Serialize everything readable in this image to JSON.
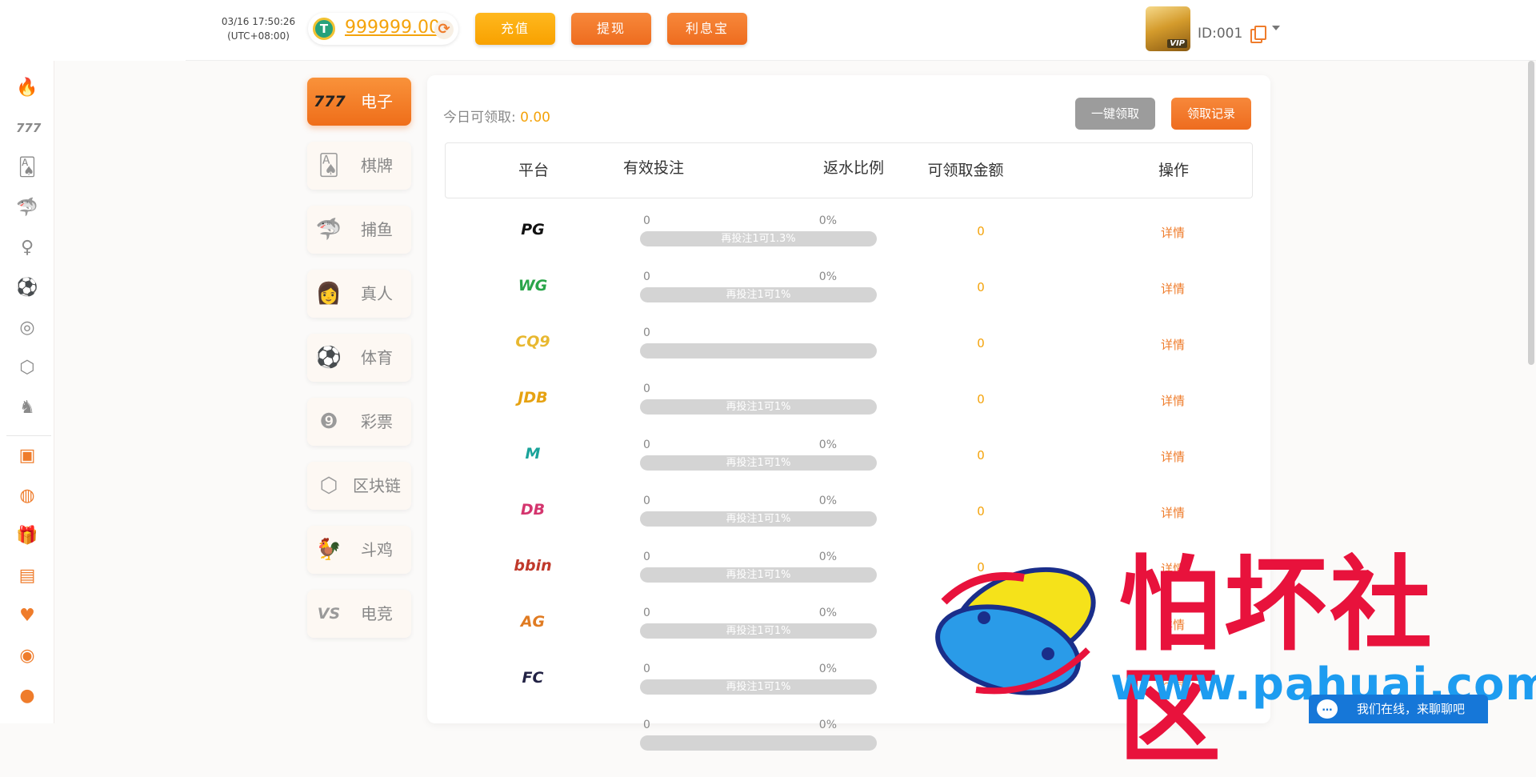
{
  "header": {
    "datetime": "03/16 17:50:26",
    "timezone": "(UTC+08:00)",
    "currency_icon": "T",
    "balance": "999999.00",
    "recharge_label": "充值",
    "withdraw_label": "提现",
    "interest_label": "利息宝",
    "avatar_badge": "VIP",
    "user_id": "ID:001"
  },
  "rail": {
    "icons": [
      "fire-icon",
      "slot-777-icon",
      "cards-icon",
      "fish-icon",
      "live-dealer-icon",
      "soccer-icon",
      "lottery-icon",
      "blockchain-icon",
      "rooster-icon",
      "gift-box-icon",
      "money-bag-icon",
      "gift-icon",
      "calendar-gift-icon",
      "vip-shield-icon",
      "coins-icon",
      "piggy-bank-icon"
    ]
  },
  "categories": [
    {
      "key": "slots",
      "label": "电子",
      "icon": "slot-777-icon",
      "glyph": "777",
      "active": true
    },
    {
      "key": "chess",
      "label": "棋牌",
      "icon": "cards-icon",
      "glyph": "🂡",
      "active": false
    },
    {
      "key": "fishing",
      "label": "捕鱼",
      "icon": "fish-icon",
      "glyph": "🦈",
      "active": false
    },
    {
      "key": "live",
      "label": "真人",
      "icon": "live-dealer-icon",
      "glyph": "👩",
      "active": false
    },
    {
      "key": "sports",
      "label": "体育",
      "icon": "soccer-icon",
      "glyph": "⚽",
      "active": false
    },
    {
      "key": "lottery",
      "label": "彩票",
      "icon": "lottery-icon",
      "glyph": "❾",
      "active": false
    },
    {
      "key": "blockchain",
      "label": "区块链",
      "icon": "blockchain-icon",
      "glyph": "⬡",
      "active": false
    },
    {
      "key": "cockfight",
      "label": "斗鸡",
      "icon": "rooster-icon",
      "glyph": "🐓",
      "active": false
    },
    {
      "key": "esports",
      "label": "电竞",
      "icon": "vs-icon",
      "glyph": "VS",
      "active": false
    }
  ],
  "panel": {
    "today_label": "今日可领取:",
    "today_amount": "0.00",
    "claim_all_label": "一键领取",
    "claim_record_label": "领取记录",
    "columns": {
      "platform": "平台",
      "valid_bet": "有效投注",
      "rebate_ratio": "返水比例",
      "claimable": "可领取金额",
      "action": "操作"
    },
    "rows": [
      {
        "platform": "PG",
        "logo_color": "#111111",
        "bet": "0",
        "ratio": "0%",
        "progress": 0,
        "hint": "再投注1可1.3%",
        "claimable": "0",
        "action": "详情"
      },
      {
        "platform": "WG",
        "logo_color": "#2aa54a",
        "bet": "0",
        "ratio": "0%",
        "progress": 0,
        "hint": "再投注1可1%",
        "claimable": "0",
        "action": "详情"
      },
      {
        "platform": "CQ9",
        "logo_color": "#e8b830",
        "bet": "0",
        "ratio": "",
        "progress": 0,
        "hint": "",
        "claimable": "0",
        "action": "详情"
      },
      {
        "platform": "JDB",
        "logo_color": "#e6a212",
        "bet": "0",
        "ratio": "",
        "progress": 0,
        "hint": "再投注1可1%",
        "claimable": "0",
        "action": "详情"
      },
      {
        "platform": "M",
        "logo_color": "#1aa39a",
        "bet": "0",
        "ratio": "0%",
        "progress": 0,
        "hint": "再投注1可1%",
        "claimable": "0",
        "action": "详情"
      },
      {
        "platform": "DB",
        "logo_color": "#d4356e",
        "bet": "0",
        "ratio": "0%",
        "progress": 0,
        "hint": "再投注1可1%",
        "claimable": "0",
        "action": "详情"
      },
      {
        "platform": "bbin",
        "logo_color": "#c0392b",
        "bet": "0",
        "ratio": "0%",
        "progress": 0,
        "hint": "再投注1可1%",
        "claimable": "0",
        "action": "详情"
      },
      {
        "platform": "AG",
        "logo_color": "#e07b22",
        "bet": "0",
        "ratio": "0%",
        "progress": 0,
        "hint": "再投注1可1%",
        "claimable": "",
        "action": "详情"
      },
      {
        "platform": "FC",
        "logo_color": "#222244",
        "bet": "0",
        "ratio": "0%",
        "progress": 0,
        "hint": "再投注1可1%",
        "claimable": "",
        "action": "详情"
      },
      {
        "platform": "",
        "logo_color": "#d22",
        "bet": "0",
        "ratio": "0%",
        "progress": 0,
        "hint": "",
        "claimable": "",
        "action": ""
      }
    ]
  },
  "watermark": {
    "title": "怕坏社区",
    "url": "www.pahuai.com"
  },
  "chat": {
    "text": "我们在线，来聊聊吧"
  },
  "colors": {
    "accent": "#ef7c2b",
    "amount": "#f4a30b",
    "gray_button": "#9c9c9c"
  }
}
